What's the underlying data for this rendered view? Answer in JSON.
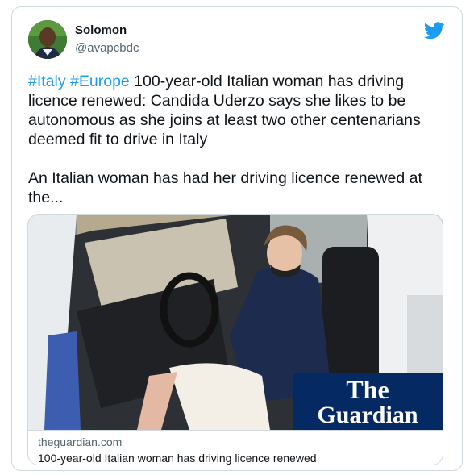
{
  "user": {
    "display_name": "Solomon",
    "handle": "@avapcbdc"
  },
  "tweet": {
    "hashtags": [
      "#Italy",
      "#Europe"
    ],
    "headline": " 100-year-old Italian woman has driving licence renewed: Candida Uderzo says she likes to be autonomous as she joins at least two other centenarians deemed fit to drive in Italy",
    "body": "An Italian woman has had her driving licence renewed at the..."
  },
  "card": {
    "logo_line1": "The",
    "logo_line2": "Guardian",
    "domain": "theguardian.com",
    "title": "100-year-old Italian woman has driving licence renewed"
  },
  "colors": {
    "accent": "#1d9bf0",
    "guardian_blue": "#052962"
  },
  "icons": {
    "brand": "twitter-bird-icon"
  }
}
